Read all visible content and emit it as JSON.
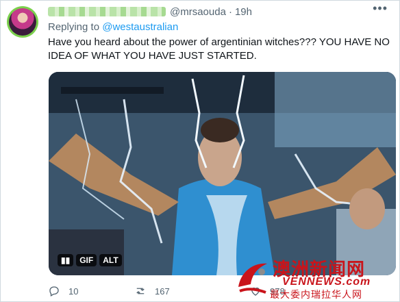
{
  "tweet": {
    "handle": "@mrsaouda",
    "separator": "·",
    "time": "19h",
    "replying_prefix": "Replying to",
    "replying_to": "@westaustralian",
    "text": "Have you heard about the power of argentinian witches??? YOU HAVE NO IDEA OF WHAT YOU HAVE JUST STARTED.",
    "media": {
      "pause_icon": "pause-icon",
      "gif_label": "GIF",
      "alt_label": "ALT"
    },
    "actions": {
      "reply_count": "10",
      "retweet_count": "167",
      "like_count": "978"
    }
  },
  "watermark": {
    "chinese": "澳洲新闻网",
    "english": "VENNEWS.com",
    "subtitle": "最大委内瑞拉华人网"
  },
  "colors": {
    "accent": "#1d9bf0",
    "secondary_text": "#536471",
    "watermark_red": "#c9141b"
  }
}
